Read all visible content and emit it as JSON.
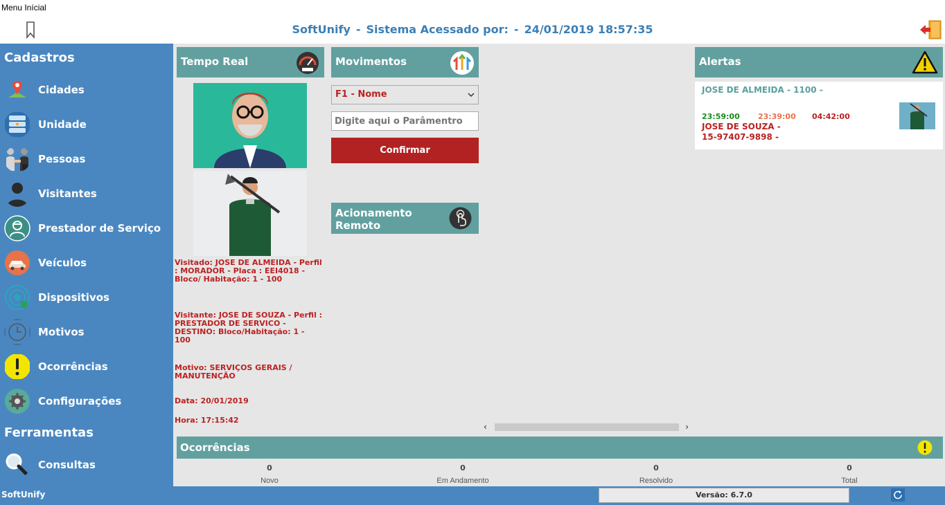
{
  "window": {
    "title": "Menu Inícial"
  },
  "header": {
    "app": "SoftUnify",
    "sep1": "-",
    "access_text": "Sistema Acessado por:",
    "user": "-",
    "datetime": "24/01/2019 18:57:35"
  },
  "sidebar": {
    "cadastros_heading": "Cadastros",
    "items": [
      {
        "label": "Cidades",
        "icon": "map-pin-icon"
      },
      {
        "label": "Unidade",
        "icon": "building-icon"
      },
      {
        "label": "Pessoas",
        "icon": "handshake-icon"
      },
      {
        "label": "Visitantes",
        "icon": "person-icon"
      },
      {
        "label": "Prestador de Serviço",
        "icon": "worker-icon"
      },
      {
        "label": "Veículos",
        "icon": "car-icon"
      },
      {
        "label": "Dispositivos",
        "icon": "device-icon"
      },
      {
        "label": "Motivos",
        "icon": "clock-icon"
      },
      {
        "label": "Ocorrências",
        "icon": "alert-icon"
      },
      {
        "label": "Configurações",
        "icon": "gear-icon"
      }
    ],
    "ferramentas_heading": "Ferramentas",
    "tools": [
      {
        "label": "Consultas",
        "icon": "magnifier-icon"
      }
    ]
  },
  "tempo_real": {
    "title": "Tempo Real",
    "visitado": "Visitado: JOSE DE ALMEIDA  - Perfil : MORADOR - Placa : EEI4018 - Bloco/ Habitação: 1 - 100",
    "visitante": "Visitante: JOSE DE SOUZA - Perfil : PRESTADOR DE SERVICO - DESTINO: Bloco/Habitação: 1 - 100",
    "motivo": "Motivo: SERVIÇOS GERAIS / MANUTENÇÃO",
    "data": "Data: 20/01/2019",
    "hora": "Hora: 17:15:42"
  },
  "movimentos": {
    "title": "Movimentos",
    "select_value": "F1 - Nome",
    "input_placeholder": "Digite aqui o Parâmentro",
    "confirm_label": "Confirmar"
  },
  "acionamento": {
    "title_line1": "Acionamento",
    "title_line2": "Remoto"
  },
  "alertas": {
    "title": "Alertas",
    "name_line": "JOSE DE ALMEIDA  - 1100 -",
    "time_green": "23:59:00",
    "time_orange": "23:39:00",
    "time_red": "04:42:00",
    "visitor_line1": "JOSE DE SOUZA -",
    "visitor_line2": "15-97407-9898 -"
  },
  "ocorrencias": {
    "title": "Ocorrências",
    "stats": [
      {
        "value": "0",
        "label": "Novo"
      },
      {
        "value": "0",
        "label": "Em Andamento"
      },
      {
        "value": "0",
        "label": "Resolvido"
      },
      {
        "value": "0",
        "label": "Total"
      }
    ]
  },
  "footer": {
    "app": "SoftUnify",
    "version": "Versão: 6.7.0"
  },
  "colors": {
    "sidebar": "#4a87c0",
    "panel_header": "#62a0a0",
    "confirm": "#b22222",
    "title_blue": "#3b7fb5",
    "alert_red": "#b22222"
  }
}
